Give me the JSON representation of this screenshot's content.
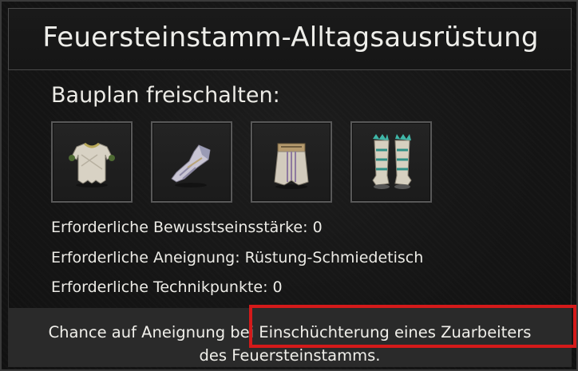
{
  "dialog": {
    "title": "Feuersteinstamm-Alltagsausrüstung",
    "section_label": "Bauplan freischalten:",
    "items": [
      {
        "icon": "tunic-armor-icon"
      },
      {
        "icon": "gloves-armor-icon"
      },
      {
        "icon": "kilt-armor-icon"
      },
      {
        "icon": "boots-armor-icon"
      }
    ],
    "requirements": [
      "Erforderliche Bewusstseinsstärke: 0",
      "Erforderliche Aneignung: Rüstung-Schmiedetisch",
      "Erforderliche Technikpunkte: 0"
    ],
    "footer": {
      "line1": "Chance auf Aneignung bei Einschüchterung eines Zuarbeiters",
      "line2": "des Feuersteinstamms."
    },
    "colors": {
      "highlight": "#d41a1a",
      "background": "#151515",
      "footer_background": "#2a2a2a",
      "text": "#ecebe6"
    }
  }
}
